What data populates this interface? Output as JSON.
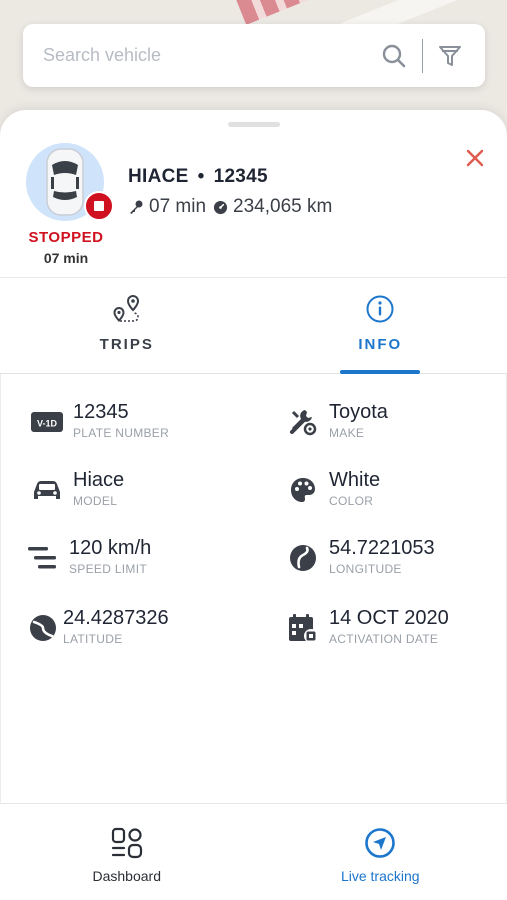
{
  "search": {
    "placeholder": "Search vehicle"
  },
  "vehicle": {
    "model": "HIACE",
    "separator": "•",
    "plate": "12345",
    "duration": "07 min",
    "odometer": "234,065 km",
    "status": "STOPPED",
    "status_duration": "07 min",
    "status_color": "#d0111f"
  },
  "tabs": [
    {
      "label": "TRIPS",
      "icon": "trips-route-icon",
      "active": false
    },
    {
      "label": "INFO",
      "icon": "info-icon",
      "active": true
    }
  ],
  "info": [
    {
      "value": "12345",
      "key": "PLATE NUMBER",
      "icon": "plate-icon"
    },
    {
      "value": "Toyota",
      "key": "MAKE",
      "icon": "tools-icon"
    },
    {
      "value": "Hiace",
      "key": "MODEL",
      "icon": "car-icon"
    },
    {
      "value": "White",
      "key": "COLOR",
      "icon": "palette-icon"
    },
    {
      "value": "120 km/h",
      "key": "SPEED LIMIT",
      "icon": "speed-lines-icon"
    },
    {
      "value": "54.7221053",
      "key": "LONGITUDE",
      "icon": "longitude-icon"
    },
    {
      "value": "24.4287326",
      "key": "LATITUDE",
      "icon": "latitude-icon"
    },
    {
      "value": "14 OCT 2020",
      "key": "ACTIVATION DATE",
      "icon": "calendar-icon"
    }
  ],
  "plate_icon_text": "V-1D",
  "nav": [
    {
      "label": "Dashboard",
      "icon": "dashboard-icon",
      "active": false
    },
    {
      "label": "Live tracking",
      "icon": "navigation-icon",
      "active": true
    }
  ],
  "colors": {
    "accent": "#1c76cc",
    "stopped": "#d0111f",
    "close": "#e05a4e"
  }
}
